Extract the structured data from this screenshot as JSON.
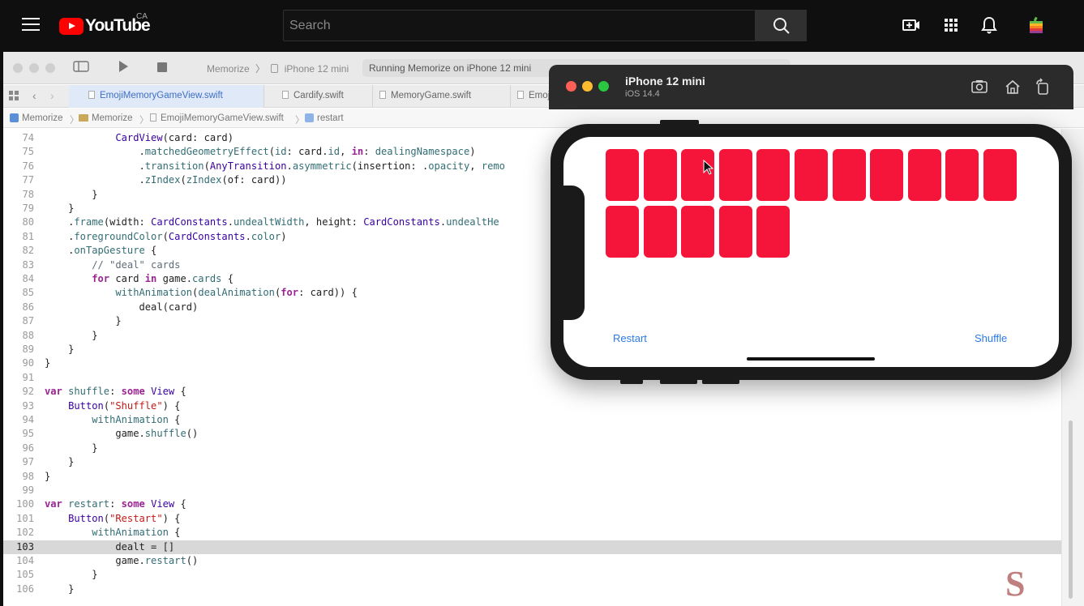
{
  "youtube": {
    "logo_text": "YouTube",
    "region": "CA",
    "search_placeholder": "Search",
    "icons": [
      "menu-icon",
      "search-icon",
      "create-video-icon",
      "apps-grid-icon",
      "notifications-bell-icon",
      "account-avatar-icon"
    ]
  },
  "xcode": {
    "toolbar": {
      "scheme_project": "Memorize",
      "scheme_device": "iPhone 12 mini",
      "activity_status": "Running Memorize on iPhone 12 mini"
    },
    "tabs": [
      {
        "label": "EmojiMemoryGameView.swift",
        "active": true
      },
      {
        "label": "Cardify.swift",
        "active": false
      },
      {
        "label": "MemoryGame.swift",
        "active": false
      },
      {
        "label": "Emoj",
        "active": false
      }
    ],
    "breadcrumb": [
      "Memorize",
      "Memorize",
      "EmojiMemoryGameView.swift",
      "restart"
    ],
    "code": {
      "highlighted_line": "103",
      "lines": [
        {
          "n": "74",
          "t": "            CardView(card: card)"
        },
        {
          "n": "75",
          "t": "                .matchedGeometryEffect(id: card.id, in: dealingNamespace)"
        },
        {
          "n": "76",
          "t": "                .transition(AnyTransition.asymmetric(insertion: .opacity, remo"
        },
        {
          "n": "77",
          "t": "                .zIndex(zIndex(of: card))"
        },
        {
          "n": "78",
          "t": "        }"
        },
        {
          "n": "79",
          "t": "    }"
        },
        {
          "n": "80",
          "t": "    .frame(width: CardConstants.undealtWidth, height: CardConstants.undealtHe"
        },
        {
          "n": "81",
          "t": "    .foregroundColor(CardConstants.color)"
        },
        {
          "n": "82",
          "t": "    .onTapGesture {"
        },
        {
          "n": "83",
          "t": "        // \"deal\" cards"
        },
        {
          "n": "84",
          "t": "        for card in game.cards {"
        },
        {
          "n": "85",
          "t": "            withAnimation(dealAnimation(for: card)) {"
        },
        {
          "n": "86",
          "t": "                deal(card)"
        },
        {
          "n": "87",
          "t": "            }"
        },
        {
          "n": "88",
          "t": "        }"
        },
        {
          "n": "89",
          "t": "    }"
        },
        {
          "n": "90",
          "t": "}"
        },
        {
          "n": "91",
          "t": ""
        },
        {
          "n": "92",
          "t": "var shuffle: some View {"
        },
        {
          "n": "93",
          "t": "    Button(\"Shuffle\") {"
        },
        {
          "n": "94",
          "t": "        withAnimation {"
        },
        {
          "n": "95",
          "t": "            game.shuffle()"
        },
        {
          "n": "96",
          "t": "        }"
        },
        {
          "n": "97",
          "t": "    }"
        },
        {
          "n": "98",
          "t": "}"
        },
        {
          "n": "99",
          "t": ""
        },
        {
          "n": "100",
          "t": "var restart: some View {"
        },
        {
          "n": "101",
          "t": "    Button(\"Restart\") {"
        },
        {
          "n": "102",
          "t": "        withAnimation {"
        },
        {
          "n": "103",
          "t": "            dealt = []"
        },
        {
          "n": "104",
          "t": "            game.restart()"
        },
        {
          "n": "105",
          "t": "        }"
        },
        {
          "n": "106",
          "t": "    }"
        }
      ]
    },
    "watermark": "S"
  },
  "simulator": {
    "device_name": "iPhone 12 mini",
    "os_version": "iOS 14.4",
    "controls": [
      "screenshot-icon",
      "home-icon",
      "rotate-icon"
    ],
    "app": {
      "restart_label": "Restart",
      "shuffle_label": "Shuffle",
      "card_color": "#f5153a",
      "undealt_cards_row1": 11,
      "undealt_cards_row2": 5
    }
  },
  "colors": {
    "youtube_red": "#ff0000",
    "xcode_keyword": "#9b2393",
    "xcode_type": "#3900a0",
    "xcode_string": "#c41a16",
    "xcode_comment": "#5d6c79",
    "ios_tint": "#2c7be5"
  }
}
